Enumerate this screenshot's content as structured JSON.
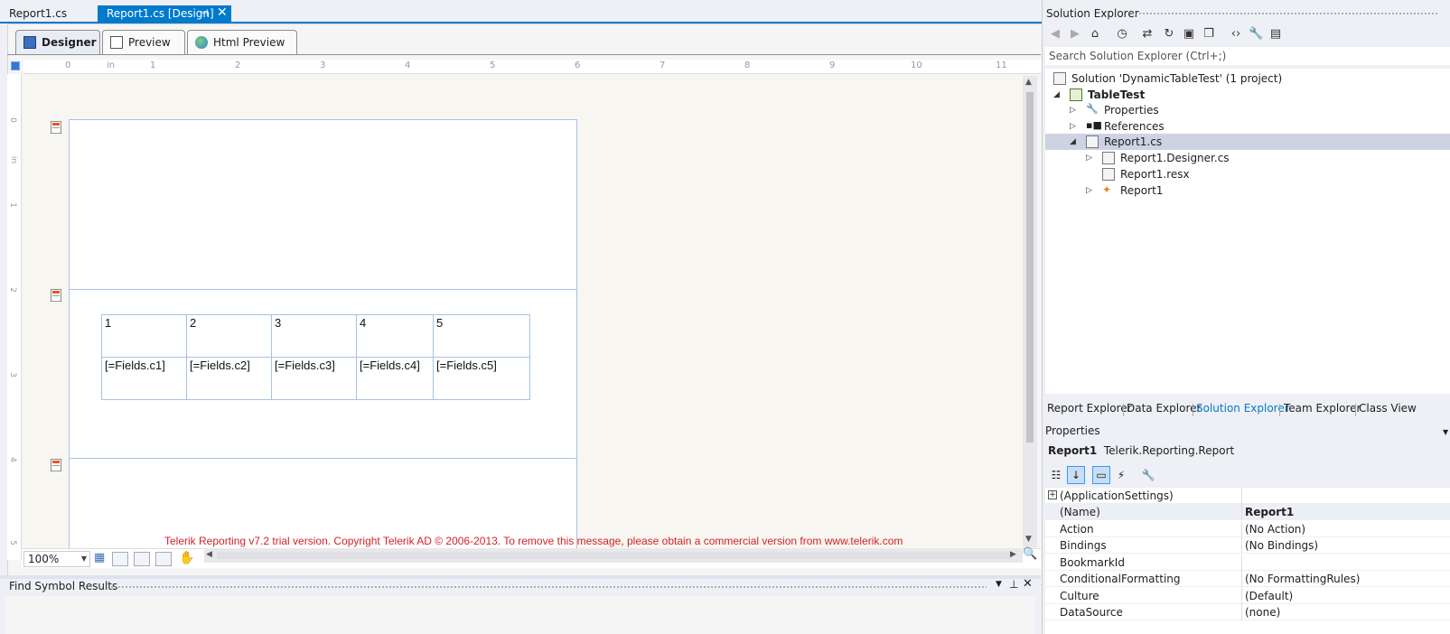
{
  "doc_tabs": {
    "tab1": "Report1.cs",
    "tab2": "Report1.cs [Design]"
  },
  "designer": {
    "subtabs": {
      "designer": "Designer",
      "preview": "Preview",
      "html_preview": "Html Preview"
    },
    "ruler_top": [
      "0",
      "in",
      "1",
      "2",
      "3",
      "4",
      "5",
      "6",
      "7",
      "8",
      "9",
      "10",
      "11"
    ],
    "ruler_left": [
      "0",
      "in",
      "1",
      "2",
      "3",
      "4",
      "5"
    ],
    "table": {
      "header": [
        "1",
        "2",
        "3",
        "4",
        "5"
      ],
      "fields": [
        "[=Fields.c1]",
        "[=Fields.c2]",
        "[=Fields.c3]",
        "[=Fields.c4]",
        "[=Fields.c5]"
      ]
    },
    "trial_message": "Telerik Reporting v7.2 trial version. Copyright Telerik AD © 2006-2013. To remove this message, please obtain a commercial version from www.telerik.com",
    "zoom": "100%"
  },
  "find_panel": {
    "title": "Find Symbol Results"
  },
  "solution_explorer": {
    "title": "Solution Explorer",
    "search_placeholder": "Search Solution Explorer (Ctrl+;)",
    "tree": {
      "solution": "Solution 'DynamicTableTest' (1 project)",
      "project": "TableTest",
      "properties": "Properties",
      "references": "References",
      "report_cs": "Report1.cs",
      "designer_cs": "Report1.Designer.cs",
      "resx": "Report1.resx",
      "report_class": "Report1"
    },
    "bottom_tabs": [
      "Report Explorer",
      "Data Explorer",
      "Solution Explorer",
      "Team Explorer",
      "Class View"
    ]
  },
  "properties": {
    "title": "Properties",
    "object_name": "Report1",
    "object_type": "Telerik.Reporting.Report",
    "rows": [
      {
        "name": "(ApplicationSettings)",
        "value": ""
      },
      {
        "name": "(Name)",
        "value": "Report1"
      },
      {
        "name": "Action",
        "value": "(No Action)"
      },
      {
        "name": "Bindings",
        "value": "(No Bindings)"
      },
      {
        "name": "BookmarkId",
        "value": ""
      },
      {
        "name": "ConditionalFormatting",
        "value": "(No FormattingRules)"
      },
      {
        "name": "Culture",
        "value": "(Default)"
      },
      {
        "name": "DataSource",
        "value": "(none)"
      }
    ]
  },
  "colors": {
    "accent": "#007acc",
    "trial_text": "#d2232a",
    "band_border": "#a8c1e8"
  }
}
